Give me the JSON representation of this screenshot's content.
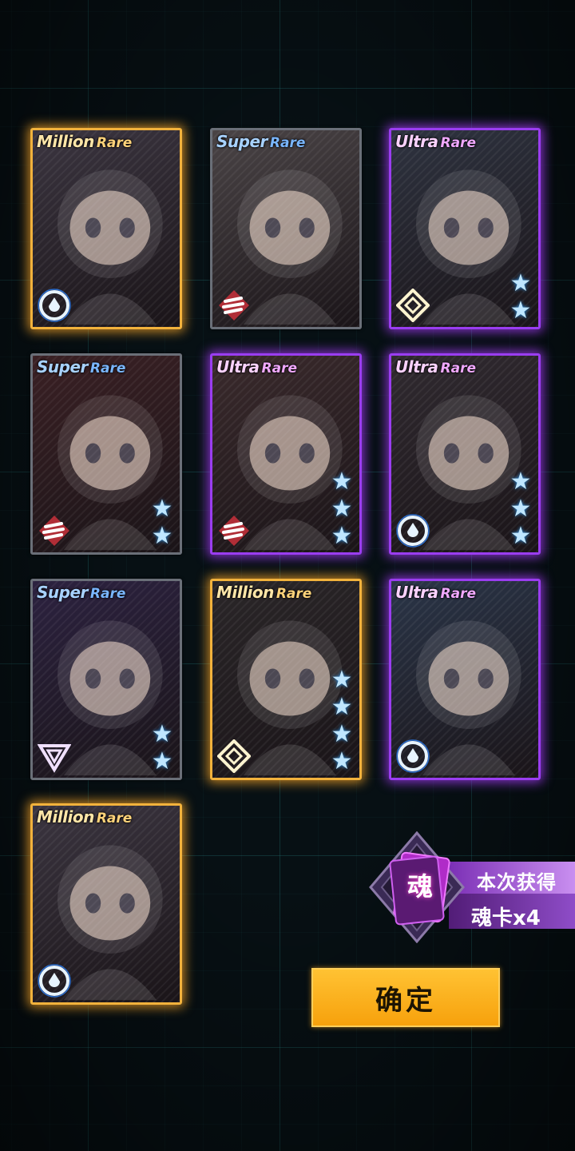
{
  "cards": [
    {
      "rarity_main": "Million",
      "rarity_sub": "Rare",
      "tier": "mr",
      "stars": 0,
      "emblem": "circle-drop-emblem",
      "bg": "#3b3540"
    },
    {
      "rarity_main": "Super",
      "rarity_sub": "Rare",
      "tier": "sr",
      "stars": 0,
      "emblem": "stripes-emblem",
      "bg": "#4a4446"
    },
    {
      "rarity_main": "Ultra",
      "rarity_sub": "Rare",
      "tier": "ur",
      "stars": 2,
      "emblem": "diamond-emblem",
      "bg": "#2e3340"
    },
    {
      "rarity_main": "Super",
      "rarity_sub": "Rare",
      "tier": "sr",
      "stars": 2,
      "emblem": "stripes-emblem",
      "bg": "#3a2024"
    },
    {
      "rarity_main": "Ultra",
      "rarity_sub": "Rare",
      "tier": "ur",
      "stars": 3,
      "emblem": "stripes-emblem",
      "bg": "#3a2a2c"
    },
    {
      "rarity_main": "Ultra",
      "rarity_sub": "Rare",
      "tier": "ur",
      "stars": 3,
      "emblem": "circle-drop-emblem",
      "bg": "#302a30"
    },
    {
      "rarity_main": "Super",
      "rarity_sub": "Rare",
      "tier": "sr",
      "stars": 2,
      "emblem": "triangle-emblem",
      "bg": "#2c2240"
    },
    {
      "rarity_main": "Million",
      "rarity_sub": "Rare",
      "tier": "mr",
      "stars": 4,
      "emblem": "diamond-emblem",
      "bg": "#2a2628"
    },
    {
      "rarity_main": "Ultra",
      "rarity_sub": "Rare",
      "tier": "ur",
      "stars": 0,
      "emblem": "circle-drop-emblem",
      "bg": "#2a3548"
    },
    {
      "rarity_main": "Million",
      "rarity_sub": "Rare",
      "tier": "mr",
      "stars": 0,
      "emblem": "circle-drop-emblem",
      "bg": "#3b3540"
    }
  ],
  "soul_card": {
    "icon_char": "魂",
    "obtained_label": "本次获得",
    "count_label": "魂卡x4"
  },
  "confirm_button": {
    "label": "确定"
  },
  "star_glyph": "★"
}
